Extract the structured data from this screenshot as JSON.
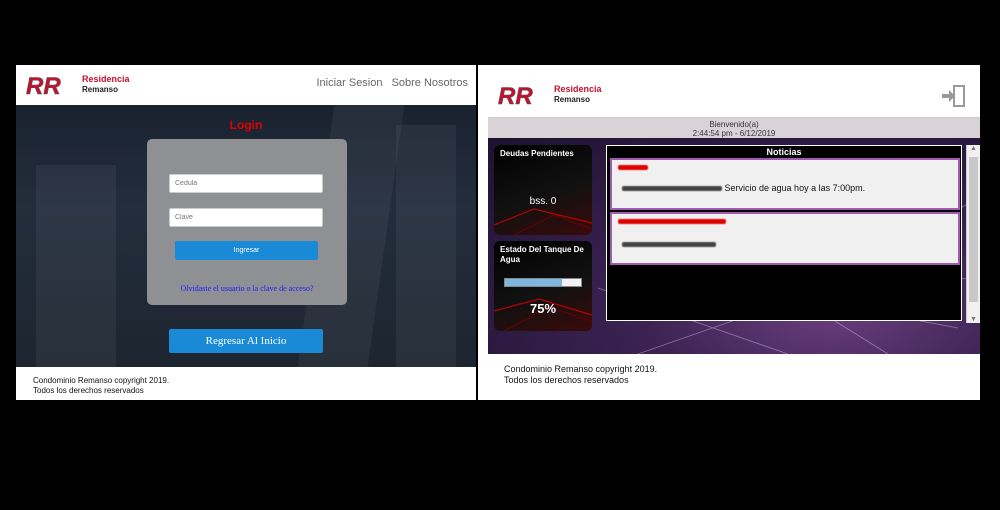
{
  "brand": {
    "line1": "Residencia",
    "line2": "Remanso",
    "mark": "RR"
  },
  "login_page": {
    "nav": [
      "Iniciar Sesion",
      "Sobre Nosotros"
    ],
    "title": "Login",
    "cedula_placeholder": "Cedula",
    "clave_placeholder": "Clave",
    "ingresar": "Ingresar",
    "forgot": "Olvidaste el usuario o la clave de acceso?",
    "back": "Regresar Al Inicio"
  },
  "dashboard": {
    "welcome": "Bienvenido(a)",
    "datetime": "2:44:54 pm - 6/12/2019",
    "debts_title": "Deudas Pendientes",
    "debts_value": "bss. 0",
    "tank_title": "Estado Del Tanque De Agua",
    "tank_value": "75%",
    "tank_level": 0.75,
    "news_title": "Noticias",
    "news_item_1_text": "Servicio de agua hoy a las 7:00pm."
  },
  "footer": {
    "line1": "Condominio Remanso copyright 2019.",
    "line2": "Todos los derechos reservados"
  },
  "colors": {
    "accent_blue": "#1a8ad6",
    "alert_red": "#e00000",
    "news_border": "#a05ab0"
  },
  "icons": {
    "exit": "exit-door-icon"
  }
}
